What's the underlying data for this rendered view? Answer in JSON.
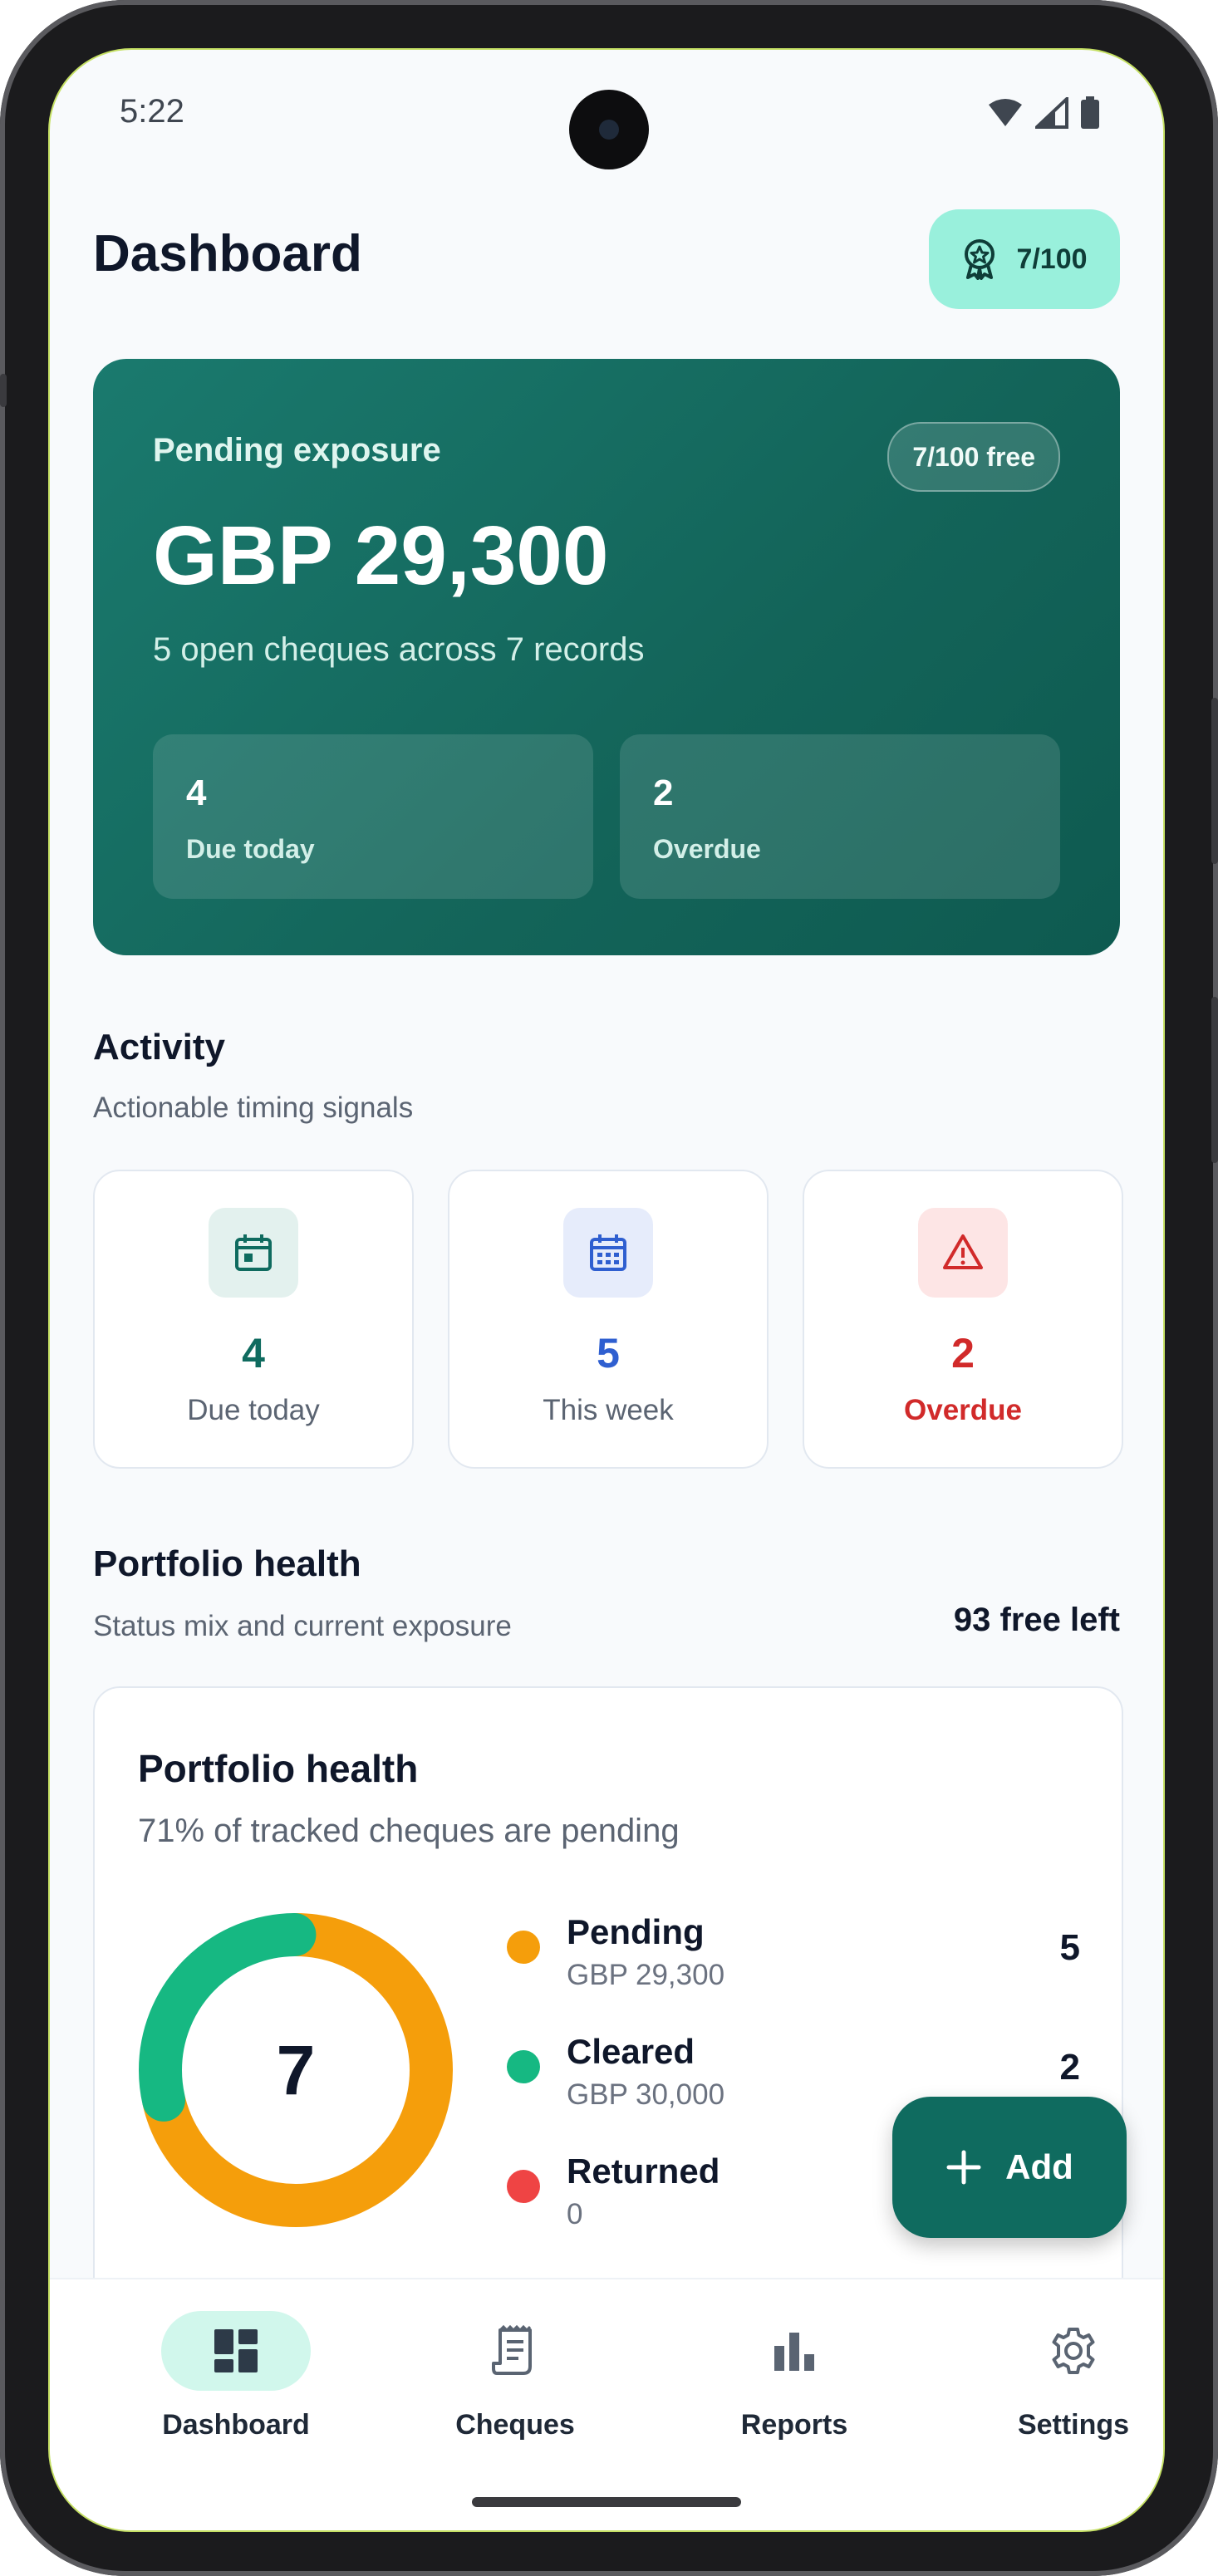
{
  "status_bar": {
    "time": "5:22"
  },
  "header": {
    "title": "Dashboard",
    "quota": "7/100"
  },
  "hero": {
    "label": "Pending exposure",
    "badge": "7/100 free",
    "amount": "GBP 29,300",
    "subtitle": "5 open cheques across 7 records",
    "stats": [
      {
        "value": "4",
        "label": "Due today"
      },
      {
        "value": "2",
        "label": "Overdue"
      }
    ]
  },
  "activity": {
    "title": "Activity",
    "subtitle": "Actionable timing signals",
    "cards": [
      {
        "value": "4",
        "label": "Due today",
        "icon": "calendar-check-icon",
        "color": "#0f6b5f",
        "bg": "#e3f1ee"
      },
      {
        "value": "5",
        "label": "This week",
        "icon": "calendar-week-icon",
        "color": "#2f5fd0",
        "bg": "#e6ecfb"
      },
      {
        "value": "2",
        "label": "Overdue",
        "icon": "warning-icon",
        "color": "#d12a2a",
        "bg": "#fde5e5"
      }
    ]
  },
  "portfolio": {
    "title": "Portfolio health",
    "subtitle": "Status mix and current exposure",
    "free_left": "93 free left",
    "card": {
      "title": "Portfolio health",
      "subtitle": "71% of tracked cheques are pending",
      "total": "7",
      "legend": [
        {
          "name": "Pending",
          "amount": "GBP 29,300",
          "count": "5",
          "color": "#f59e0b",
          "share": 5
        },
        {
          "name": "Cleared",
          "amount": "GBP 30,000",
          "count": "2",
          "color": "#16b882",
          "share": 2
        },
        {
          "name": "Returned",
          "amount": "0",
          "count": "",
          "color": "#ef4444",
          "share": 0
        }
      ]
    }
  },
  "fab": {
    "label": "Add",
    "icon": "plus-icon"
  },
  "nav": [
    {
      "label": "Dashboard",
      "icon": "dashboard-icon",
      "active": true
    },
    {
      "label": "Cheques",
      "icon": "receipt-icon",
      "active": false
    },
    {
      "label": "Reports",
      "icon": "bar-chart-icon",
      "active": false
    },
    {
      "label": "Settings",
      "icon": "gear-icon",
      "active": false
    }
  ],
  "colors": {
    "accent": "#0f6b5f",
    "accent_light": "#99f0dc",
    "nav_active_bg": "#d1f7ec"
  }
}
